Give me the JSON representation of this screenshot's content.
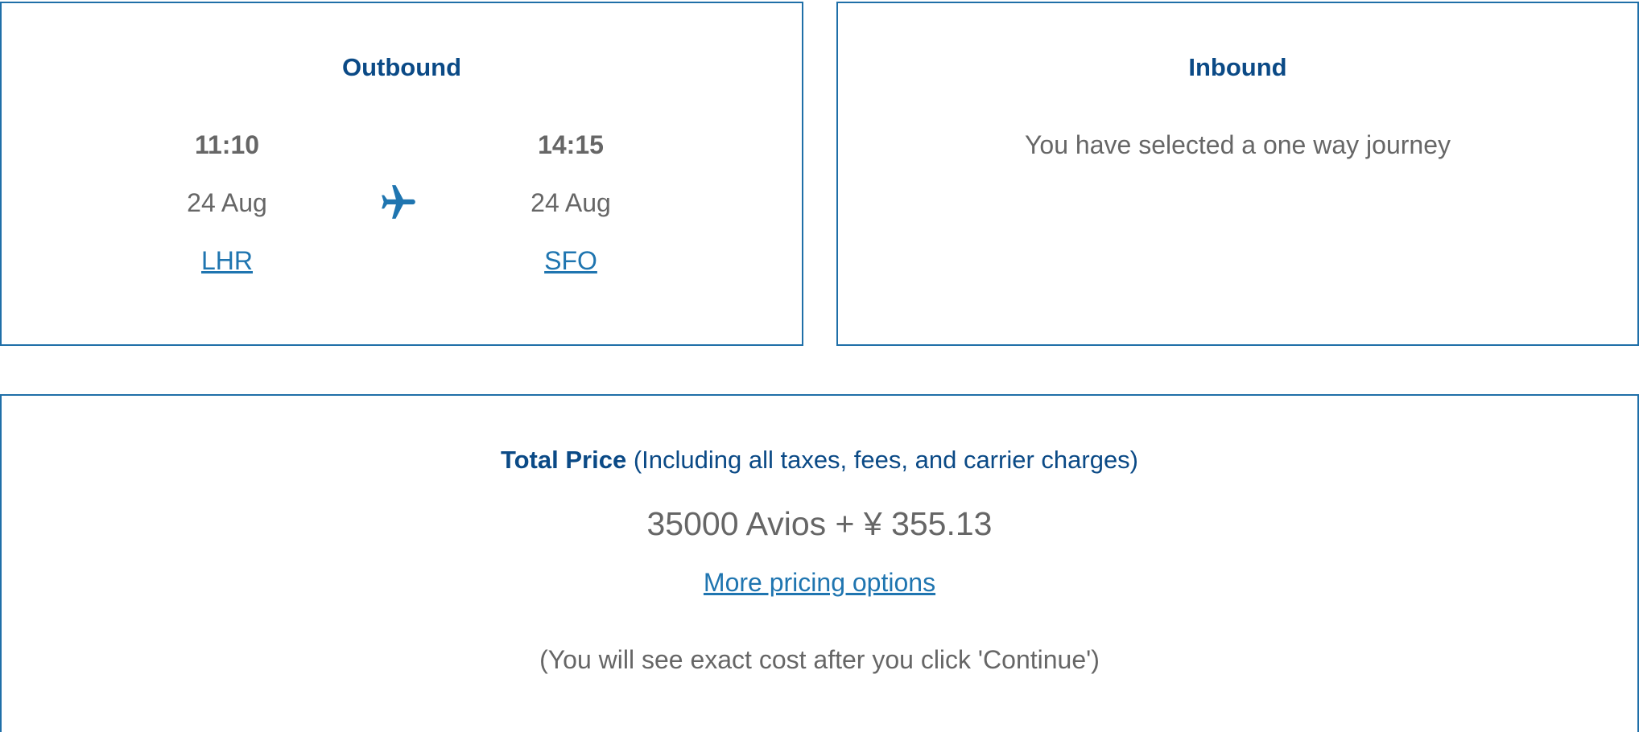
{
  "outbound": {
    "title": "Outbound",
    "departure": {
      "time": "11:10",
      "date": "24 Aug",
      "airport": "LHR"
    },
    "arrival": {
      "time": "14:15",
      "date": "24 Aug",
      "airport": "SFO"
    },
    "icon": "plane-icon"
  },
  "inbound": {
    "title": "Inbound",
    "message": "You have selected a one way journey"
  },
  "price": {
    "title_strong": "Total Price",
    "title_note": "(Including all taxes, fees, and carrier charges)",
    "value": "35000 Avios + ¥ 355.13",
    "more_options_link": "More pricing options",
    "note": "(You will see exact cost after you click 'Continue')"
  },
  "colors": {
    "border": "#1f6fa8",
    "heading": "#0b4a86",
    "link": "#1f75b0",
    "text": "#666666"
  }
}
